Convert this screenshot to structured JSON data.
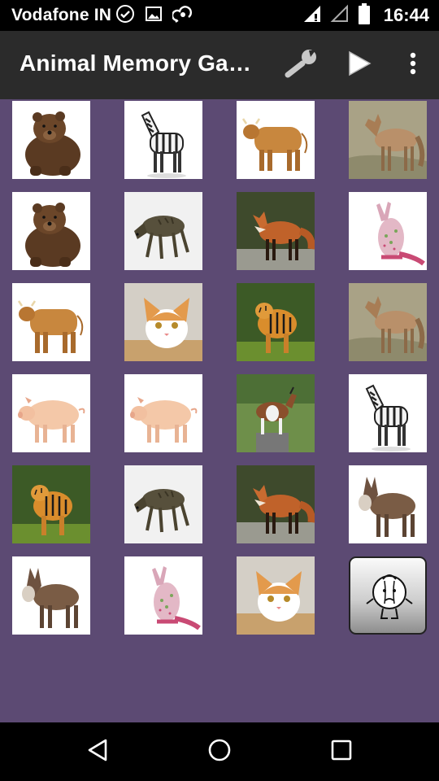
{
  "status_bar": {
    "carrier": "Vodafone IN",
    "time": "16:44",
    "left_icons": [
      "check-circle-icon",
      "image-icon",
      "sync-cloud-icon"
    ],
    "right_icons": [
      "signal-full-icon",
      "signal-empty-icon",
      "battery-icon"
    ]
  },
  "app_bar": {
    "title": "Animal Memory Game",
    "actions": [
      "wrench-icon",
      "play-icon",
      "overflow-menu-icon"
    ]
  },
  "board": {
    "background": "#5c4a73",
    "rows": 6,
    "cols": 4,
    "tiles": [
      "bear",
      "zebra",
      "cow",
      "jackal",
      "bear",
      "hyena",
      "fox",
      "kangaroo",
      "cow",
      "cat",
      "tiger",
      "jackal",
      "pig",
      "pig",
      "goat",
      "zebra",
      "tiger",
      "hyena",
      "fox",
      "donkey",
      "donkey",
      "kangaroo",
      "cat",
      "hidden"
    ]
  },
  "nav_bar": {
    "buttons": [
      "back-icon",
      "home-icon",
      "recents-icon"
    ]
  }
}
